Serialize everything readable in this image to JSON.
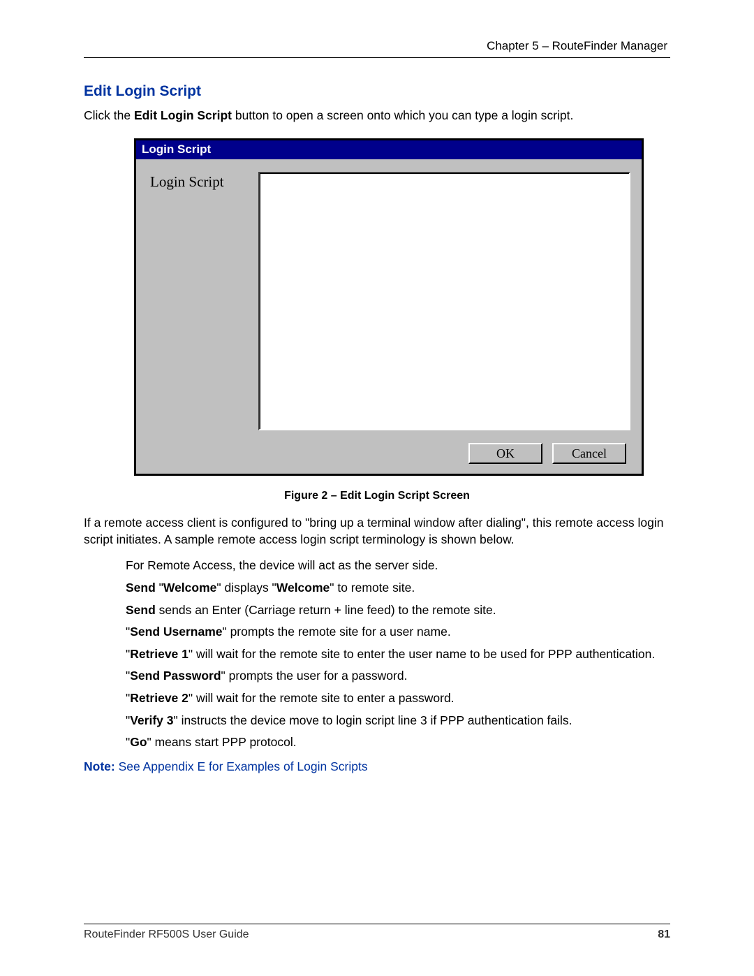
{
  "header": {
    "chapter_line": "Chapter 5 – RouteFinder Manager"
  },
  "section": {
    "heading": "Edit Login Script",
    "intro_pre": "Click the ",
    "intro_bold": "Edit Login Script",
    "intro_post": " button to open a screen onto which you can type a login script."
  },
  "dialog": {
    "title": "Login Script",
    "label": "Login Script",
    "textarea_value": "",
    "ok_label": "OK",
    "cancel_label": "Cancel"
  },
  "figure_caption": "Figure 2 – Edit Login Script Screen",
  "paragraph1": "If a remote access client is configured to \"bring up a terminal window after dialing\", this remote access login script initiates. A sample remote access login script terminology is shown below.",
  "bullets": {
    "b1": "For Remote Access, the device will act as the server side.",
    "b2_bold1": "Send",
    "b2_t1": " \"",
    "b2_bold2": "Welcome",
    "b2_t2": "\" displays \"",
    "b2_bold3": "Welcome",
    "b2_t3": "\" to remote site.",
    "b3_bold": "Send",
    "b3_rest": " sends an Enter (Carriage return + line feed) to the remote site.",
    "b4_t1": "\"",
    "b4_bold": "Send Username",
    "b4_t2": "\" prompts the remote site for a user name.",
    "b5_t1": "\"",
    "b5_bold": "Retrieve 1",
    "b5_t2": "\" will wait for the remote site to enter the user name to be used for PPP authentication.",
    "b6_t1": "\"",
    "b6_bold": "Send Password",
    "b6_t2": "\" prompts the user for a password.",
    "b7_t1": "\"",
    "b7_bold": "Retrieve 2",
    "b7_t2": "\" will wait for the remote site to enter a password.",
    "b8_t1": "\"",
    "b8_bold": "Verify 3",
    "b8_t2": "\" instructs the device move to login script line 3 if PPP authentication fails.",
    "b9_t1": "\"",
    "b9_bold": "Go",
    "b9_t2": "\" means start PPP protocol."
  },
  "note": {
    "label": "Note:",
    "text": " See Appendix E for Examples of Login Scripts"
  },
  "footer": {
    "left": "RouteFinder RF500S User Guide",
    "page": "81"
  }
}
